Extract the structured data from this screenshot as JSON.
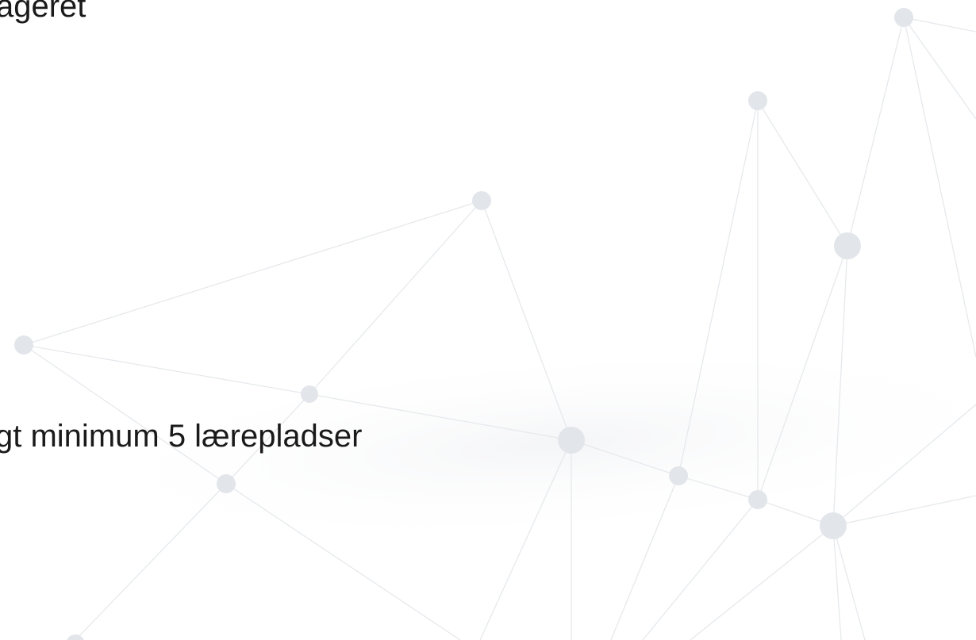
{
  "slide": {
    "lines": [
      "ageret",
      "gt minimum 5 lærepladser"
    ]
  },
  "background": {
    "decoration": "network-graph",
    "node_color": "#e2e6ea",
    "edge_color": "#e8ebee"
  }
}
